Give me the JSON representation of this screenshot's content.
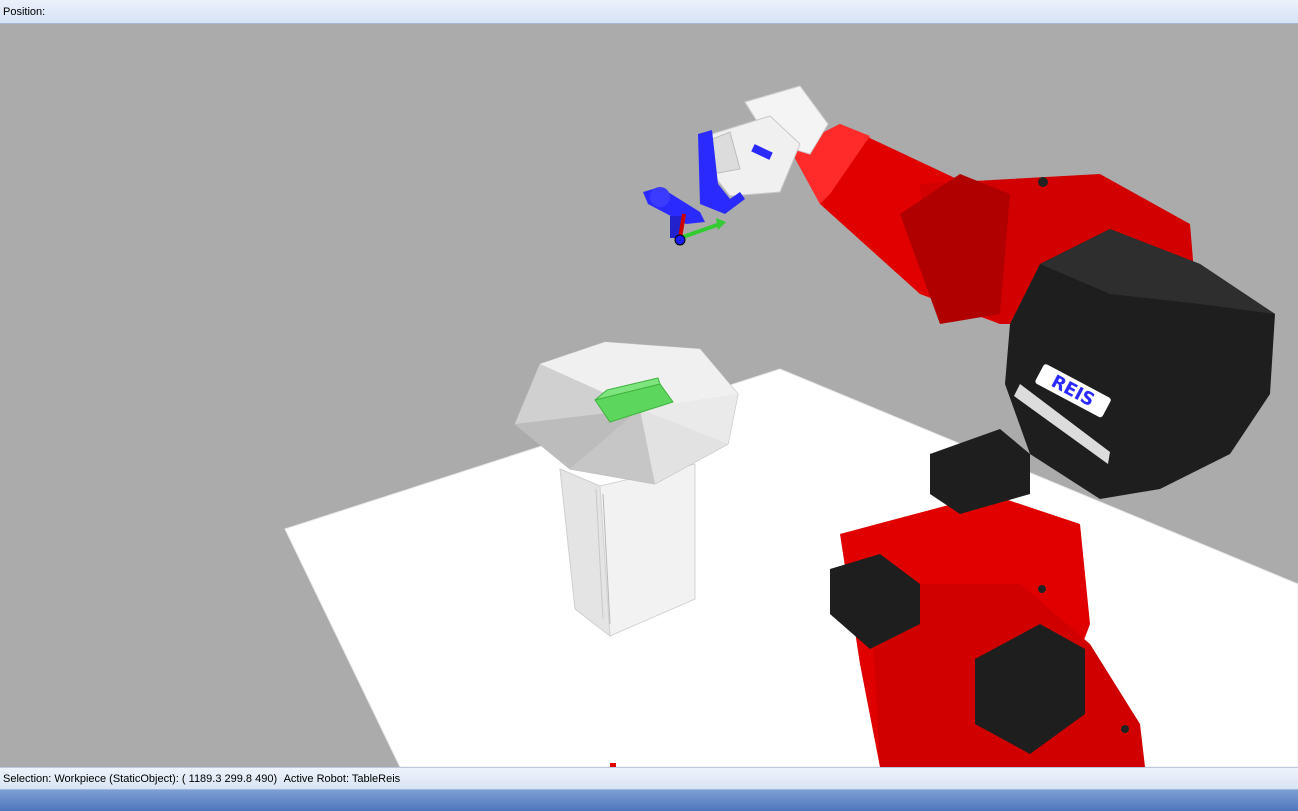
{
  "header": {
    "position_label": "Position:"
  },
  "status": {
    "selection_text": "Selection: Workpiece (StaticObject): ( 1189.3 299.8 490)",
    "active_robot_text": "Active Robot: TableReis"
  },
  "scene": {
    "brand_logo_text": "REIS",
    "colors": {
      "background": "#ababab",
      "robot_red": "#e00000",
      "robot_dark_red": "#a80000",
      "robot_black": "#1e1e1e",
      "gripper_blue": "#2a2aff",
      "workpiece_green": "#5cd65c",
      "table_white": "#ffffff",
      "pedestal_gray": "#e6e6e6"
    }
  }
}
